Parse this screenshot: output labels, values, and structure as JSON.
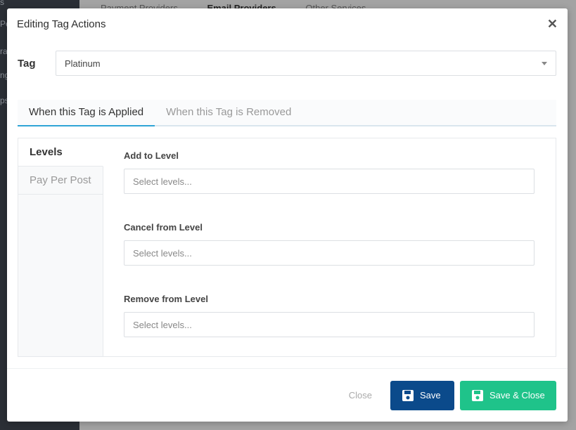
{
  "background": {
    "sidebar_fragments": [
      "s",
      "Pe",
      "ra",
      "ng",
      "ps"
    ],
    "tabs": [
      "Payment Providers",
      "Email Providers",
      "Other Services"
    ]
  },
  "modal": {
    "title": "Editing Tag Actions",
    "close_icon": "close-icon",
    "tag_label": "Tag",
    "tag_value": "Platinum",
    "tabs": [
      {
        "label": "When this Tag is Applied",
        "active": true
      },
      {
        "label": "When this Tag is Removed",
        "active": false
      }
    ],
    "side_nav": [
      {
        "label": "Levels",
        "active": true
      },
      {
        "label": "Pay Per Post",
        "active": false
      }
    ],
    "fields": [
      {
        "label": "Add to Level",
        "placeholder": "Select levels..."
      },
      {
        "label": "Cancel from Level",
        "placeholder": "Select levels..."
      },
      {
        "label": "Remove from Level",
        "placeholder": "Select levels..."
      }
    ],
    "footer": {
      "close_label": "Close",
      "save_label": "Save",
      "save_close_label": "Save & Close",
      "save_icon": "floppy-disk-icon"
    }
  },
  "colors": {
    "primary": "#0b4a8b",
    "success": "#1fc38a",
    "tab_accent": "#2fa4d6"
  }
}
